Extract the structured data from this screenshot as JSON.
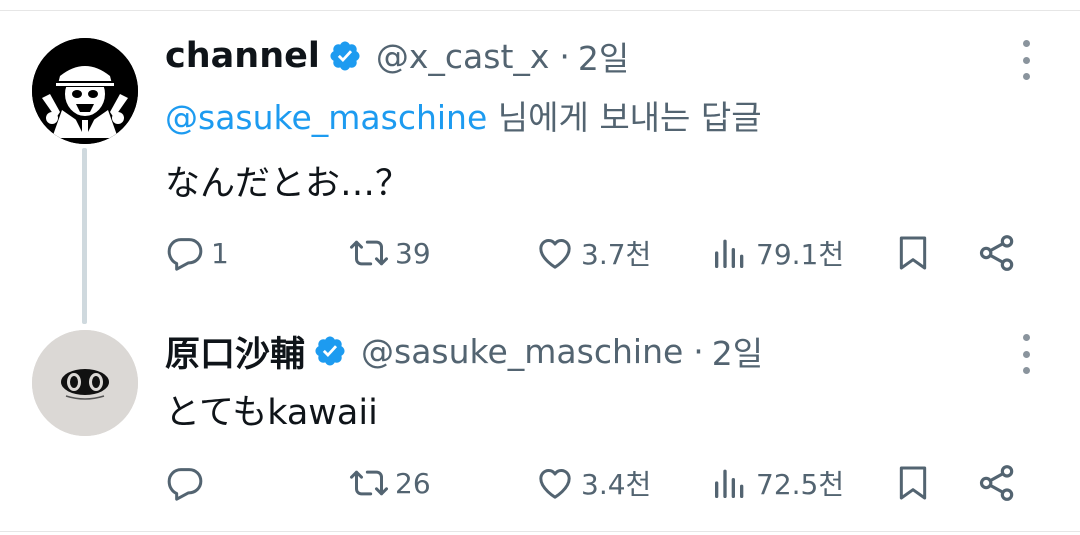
{
  "tweets": [
    {
      "display_name": "channel",
      "handle": "@x_cast_x",
      "separator": "·",
      "time": "2일",
      "reply_to_mention": "@sasuke_maschine",
      "reply_to_suffix": " 님에게 보내는 답글",
      "text": "なんだとお…？",
      "replies": "1",
      "reposts": "39",
      "likes": "3.7천",
      "views": "79.1천"
    },
    {
      "display_name": "原口沙輔",
      "handle": "@sasuke_maschine",
      "separator": "·",
      "time": "2일",
      "text": "とてもkawaii",
      "replies": "",
      "reposts": "26",
      "likes": "3.4천",
      "views": "72.5천"
    }
  ],
  "colors": {
    "accent": "#1d9bf0",
    "secondary_text": "#536471",
    "thread_line": "#cfd9de"
  },
  "icons": [
    "verified-badge-icon",
    "more-icon",
    "reply-icon",
    "repost-icon",
    "like-icon",
    "views-icon",
    "bookmark-icon",
    "share-icon"
  ]
}
